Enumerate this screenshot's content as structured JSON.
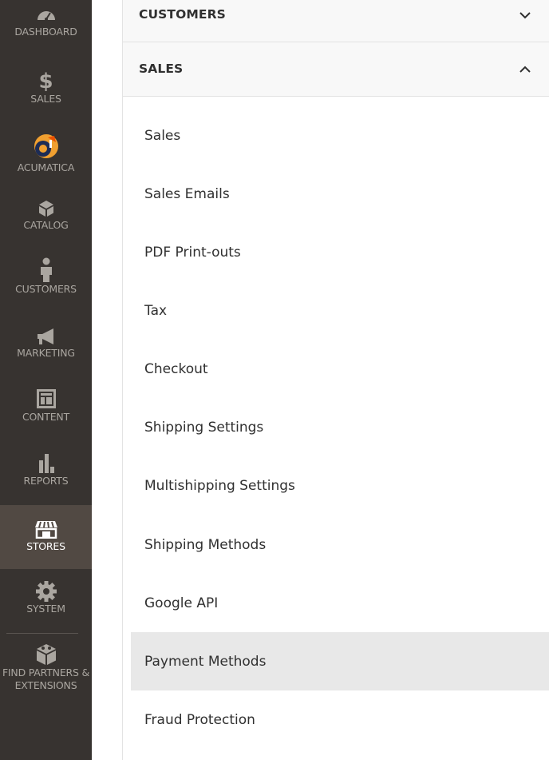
{
  "sidebar": {
    "items": [
      {
        "label": "DASHBOARD",
        "icon": "dashboard-icon"
      },
      {
        "label": "SALES",
        "icon": "dollar-icon"
      },
      {
        "label": "ACUMATICA",
        "icon": "acumatica-logo-icon"
      },
      {
        "label": "CATALOG",
        "icon": "cube-icon"
      },
      {
        "label": "CUSTOMERS",
        "icon": "person-icon"
      },
      {
        "label": "MARKETING",
        "icon": "megaphone-icon"
      },
      {
        "label": "CONTENT",
        "icon": "layout-icon"
      },
      {
        "label": "REPORTS",
        "icon": "bar-chart-icon"
      },
      {
        "label": "STORES",
        "icon": "storefront-icon"
      },
      {
        "label": "SYSTEM",
        "icon": "gear-icon"
      },
      {
        "label": "FIND PARTNERS & EXTENSIONS",
        "icon": "blocks-icon"
      }
    ],
    "active_index": 8
  },
  "config": {
    "customers_section": {
      "title": "CUSTOMERS",
      "expanded": false
    },
    "sales_section": {
      "title": "SALES",
      "expanded": true,
      "items": [
        "Sales",
        "Sales Emails",
        "PDF Print-outs",
        "Tax",
        "Checkout",
        "Shipping Settings",
        "Multishipping Settings",
        "Shipping Methods",
        "Google API",
        "Payment Methods",
        "Fraud Protection"
      ],
      "active_item": "Payment Methods"
    }
  },
  "colors": {
    "sidebar_bg": "#373330",
    "sidebar_active_bg": "#514943",
    "sidebar_text": "#aaa6a0",
    "accent_orange": "#eb5202",
    "panel_bg": "#f8f8f8",
    "active_item_bg": "#e8e8e8"
  }
}
